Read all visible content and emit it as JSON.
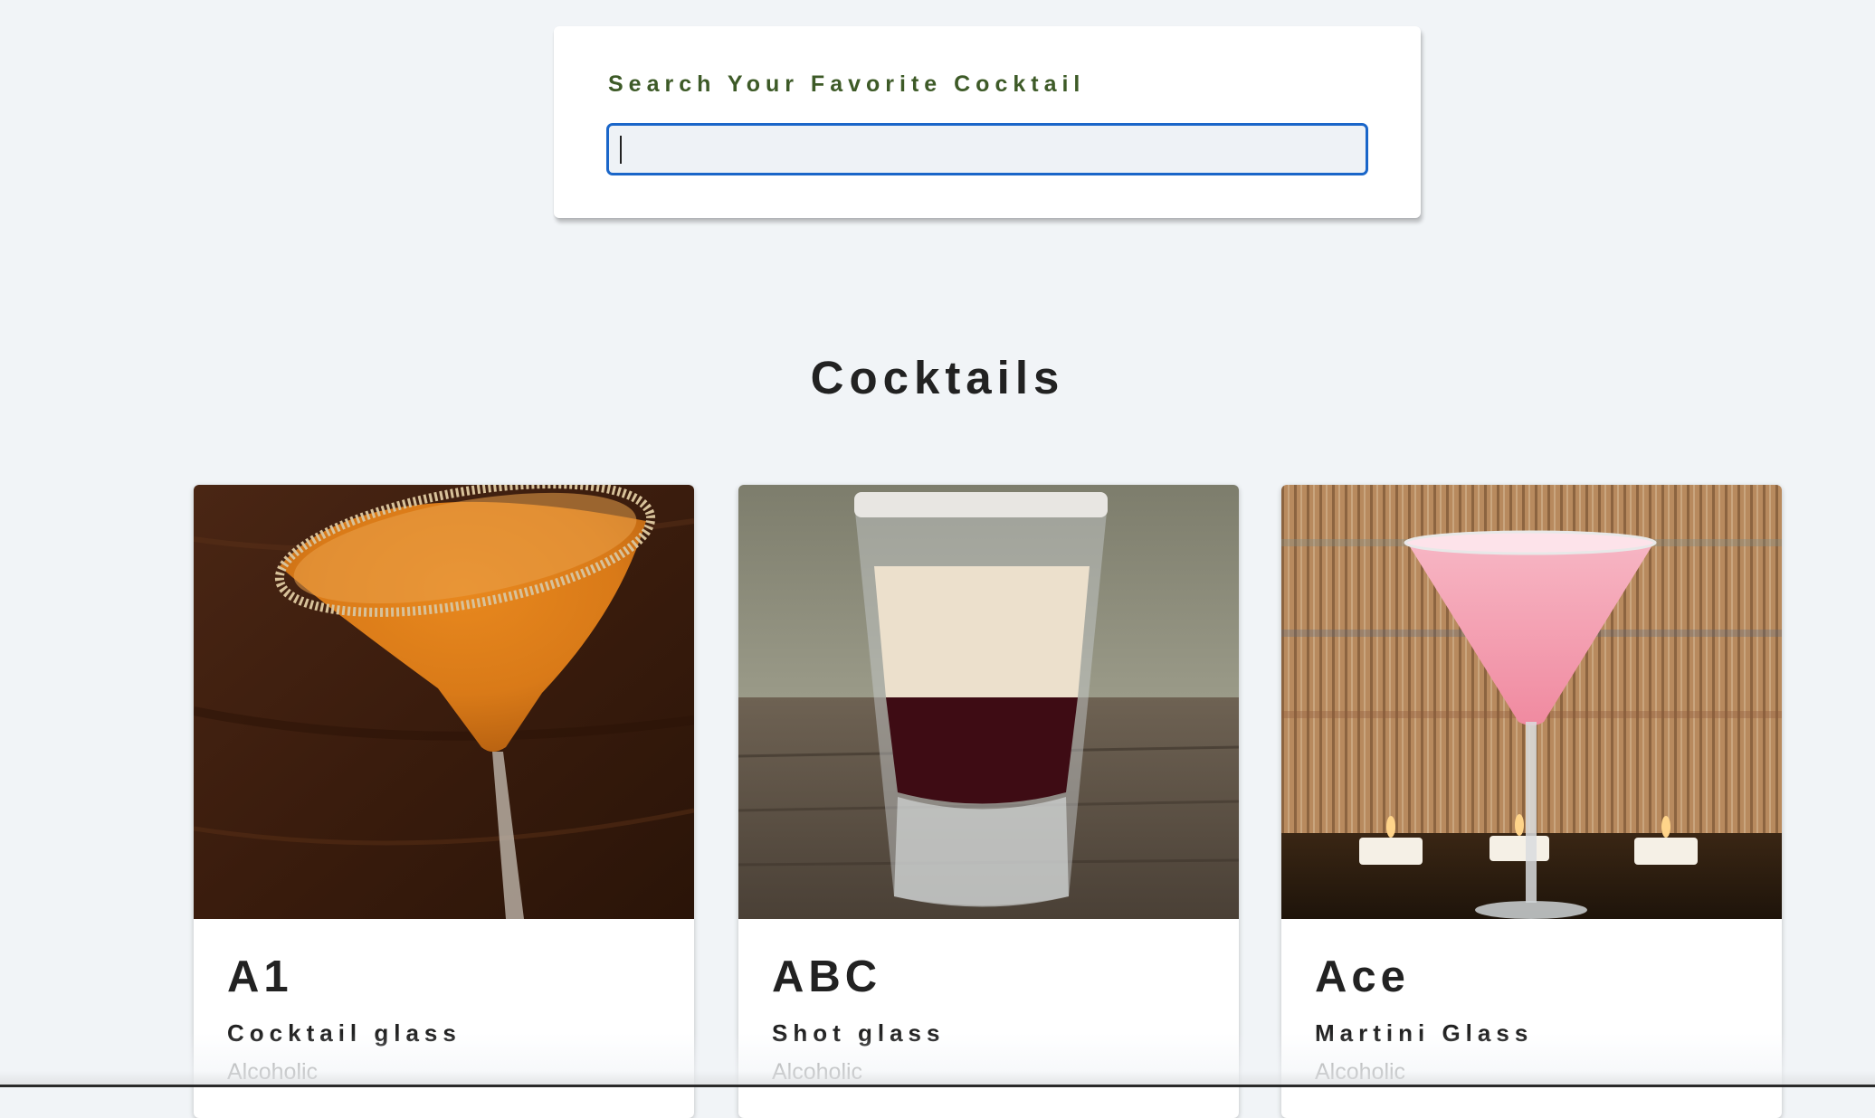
{
  "search": {
    "label": "Search Your Favorite Cocktail",
    "value": "",
    "placeholder": ""
  },
  "section": {
    "title": "Cocktails"
  },
  "cocktails": [
    {
      "name": "A1",
      "glass": "Cocktail glass",
      "type": "Alcoholic",
      "image": "orange-martini-photo"
    },
    {
      "name": "ABC",
      "glass": "Shot glass",
      "type": "Alcoholic",
      "image": "layered-shot-photo"
    },
    {
      "name": "Ace",
      "glass": "Martini Glass",
      "type": "Alcoholic",
      "image": "pink-martini-photo"
    }
  ],
  "colors": {
    "background": "#f1f4f7",
    "label_green": "#3d5a27",
    "focus_blue": "#1a66c9",
    "muted_text": "#9a9a9a"
  }
}
